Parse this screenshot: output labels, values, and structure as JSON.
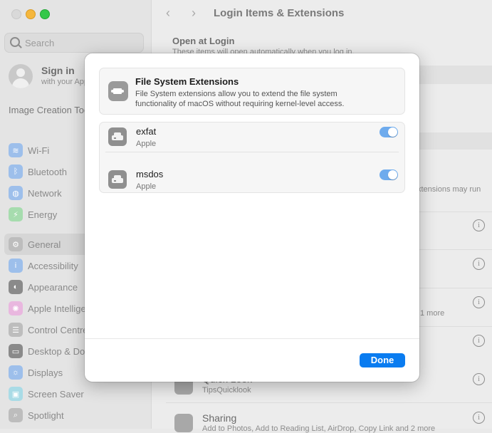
{
  "window": {
    "title": "Login Items & Extensions"
  },
  "sidebar": {
    "search_placeholder": "Search",
    "account": {
      "name": "Sign in",
      "subtitle": "with your Apple Account"
    },
    "promo": "Image Creation Tools Are Here",
    "items": [
      {
        "label": "Wi-Fi",
        "icon": "wifi-icon",
        "color": "#3b8df2"
      },
      {
        "label": "Bluetooth",
        "icon": "bluetooth-icon",
        "color": "#3b8df2"
      },
      {
        "label": "Network",
        "icon": "globe-icon",
        "color": "#3b8df2"
      },
      {
        "label": "Energy",
        "icon": "energy-icon",
        "color": "#3cc24b"
      },
      {
        "label": "General",
        "icon": "gear-icon",
        "color": "#8e8e93",
        "selected": true
      },
      {
        "label": "Accessibility",
        "icon": "accessibility-icon",
        "color": "#3b8df2"
      },
      {
        "label": "Appearance",
        "icon": "appearance-icon",
        "color": "#1d1d1f"
      },
      {
        "label": "Apple Intelligence",
        "icon": "apple-intelligence-icon",
        "color": "#e57bd0"
      },
      {
        "label": "Control Centre",
        "icon": "control-centre-icon",
        "color": "#8e8e93"
      },
      {
        "label": "Desktop & Dock",
        "icon": "dock-icon",
        "color": "#1d1d1f"
      },
      {
        "label": "Displays",
        "icon": "displays-icon",
        "color": "#3b8df2"
      },
      {
        "label": "Screen Saver",
        "icon": "screen-saver-icon",
        "color": "#5ac8e0"
      },
      {
        "label": "Spotlight",
        "icon": "spotlight-icon",
        "color": "#8e8e93"
      }
    ]
  },
  "main": {
    "section_title": "Open at Login",
    "section_subtitle": "These items will open automatically when you log in.",
    "peek_extensions_note": "xtensions may run",
    "peek_more": "1 more",
    "quicklook_title": "Quick Look",
    "quicklook_sub": "TipsQuicklook",
    "sharing_title": "Sharing",
    "sharing_sub": "Add to Photos, Add to Reading List, AirDrop, Copy Link and 2 more"
  },
  "sheet": {
    "header": {
      "title": "File System Extensions",
      "description": "File System extensions allow you to extend the file system functionality of macOS without requiring kernel-level access.",
      "icon": "puzzle-extension-icon"
    },
    "extensions": [
      {
        "name": "exfat",
        "developer": "Apple",
        "enabled": true,
        "icon": "drive-icon"
      },
      {
        "name": "msdos",
        "developer": "Apple",
        "enabled": true,
        "icon": "drive-icon"
      }
    ],
    "done_label": "Done",
    "accent": "#0a7cf0",
    "toggle_color": "#6eabed"
  }
}
